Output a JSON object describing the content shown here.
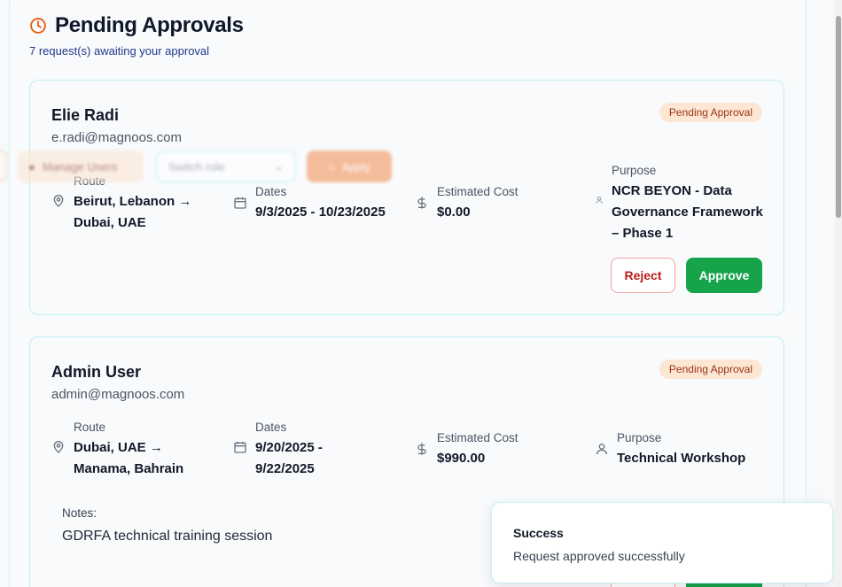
{
  "header": {
    "title": "Pending Approvals",
    "subtitle": "7 request(s) awaiting your approval",
    "icon": "clock-icon",
    "accent": "#ea580c"
  },
  "requests": [
    {
      "name": "Elie Radi",
      "email": "e.radi@magnoos.com",
      "status": "Pending Approval",
      "route_label": "Route",
      "route_line1": "Beirut, Lebanon →",
      "route_line2": "Dubai, UAE",
      "dates_label": "Dates",
      "dates": "9/3/2025 - 10/23/2025",
      "cost_label": "Estimated Cost",
      "cost": "$0.00",
      "purpose_label": "Purpose",
      "purpose_line1": "NCR BEYON - Data",
      "purpose_line2": "Governance Framework",
      "purpose_line3": "– Phase 1",
      "reject_label": "Reject",
      "approve_label": "Approve"
    },
    {
      "name": "Admin User",
      "email": "admin@magnoos.com",
      "status": "Pending Approval",
      "route_label": "Route",
      "route_line1": "Dubai, UAE →",
      "route_line2": "Manama, Bahrain",
      "dates_label": "Dates",
      "dates_line1": "9/20/2025 -",
      "dates_line2": "9/22/2025",
      "cost_label": "Estimated Cost",
      "cost": "$990.00",
      "purpose_label": "Purpose",
      "purpose": "Technical Workshop",
      "notes_label": "Notes:",
      "notes": "GDRFA technical training session"
    }
  ],
  "floating_toolbar": {
    "manage_label": "Manage Users",
    "switch_placeholder": "Switch role",
    "apply_label": "Apply"
  },
  "toast": {
    "title": "Success",
    "message": "Request approved successfully"
  },
  "colors": {
    "approve": "#16a34a",
    "reject": "#b91c1c",
    "badge_bg": "#fde7d4",
    "badge_text": "#9a3412"
  }
}
